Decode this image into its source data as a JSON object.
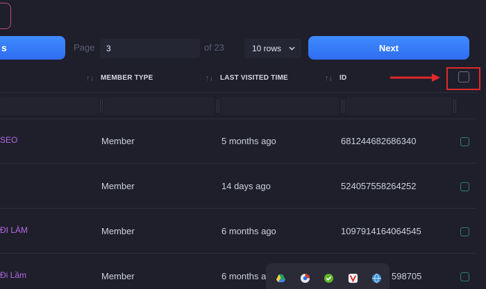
{
  "pagination": {
    "prev_label": "s",
    "page_label": "Page",
    "page_value": "3",
    "of_label": "of 23",
    "rows_value": "10 rows",
    "next_label": "Next"
  },
  "table": {
    "headers": {
      "member_type": "MEMBER TYPE",
      "last_visited": "LAST VISITED TIME",
      "id": "ID"
    },
    "rows": [
      {
        "name": "SEO",
        "member_type": "Member",
        "last_visited": "5 months ago",
        "id": "681244682686340"
      },
      {
        "name": "",
        "member_type": "Member",
        "last_visited": "14 days ago",
        "id": "524057558264252"
      },
      {
        "name": "ĐI LÀM",
        "member_type": "Member",
        "last_visited": "6 months ago",
        "id": "1097914164064545"
      },
      {
        "name": "Đi Lầm",
        "member_type": "Member",
        "last_visited": "6 months a",
        "id": "598705"
      }
    ]
  },
  "colors": {
    "accent": "#3a80ff",
    "highlight": "#e02a2a",
    "link": "#b66ae6",
    "checkbox": "#2f7f6f"
  },
  "taskbar_icons": [
    "drive-icon",
    "browser-icon",
    "shield-check-icon",
    "vivaldi-icon",
    "globe-icon"
  ]
}
